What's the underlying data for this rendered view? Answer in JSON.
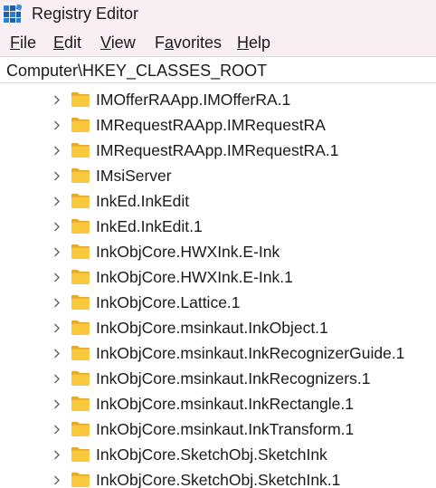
{
  "window": {
    "title": "Registry Editor",
    "icon": "registry-editor-icon"
  },
  "menu": [
    {
      "mnemonic": "F",
      "rest": "ile"
    },
    {
      "mnemonic": "E",
      "rest": "dit"
    },
    {
      "mnemonic": "V",
      "rest": "iew"
    },
    {
      "mnemonic": "",
      "pre": "F",
      "mid": "a",
      "post": "vorites"
    },
    {
      "mnemonic": "H",
      "rest": "elp"
    }
  ],
  "address": {
    "path": "Computer\\HKEY_CLASSES_ROOT"
  },
  "tree": {
    "items": [
      {
        "label": "IMOfferRAApp.IMOfferRA.1"
      },
      {
        "label": "IMRequestRAApp.IMRequestRA"
      },
      {
        "label": "IMRequestRAApp.IMRequestRA.1"
      },
      {
        "label": "IMsiServer"
      },
      {
        "label": "InkEd.InkEdit"
      },
      {
        "label": "InkEd.InkEdit.1"
      },
      {
        "label": "InkObjCore.HWXInk.E-Ink"
      },
      {
        "label": "InkObjCore.HWXInk.E-Ink.1"
      },
      {
        "label": "InkObjCore.Lattice.1"
      },
      {
        "label": "InkObjCore.msinkaut.InkObject.1"
      },
      {
        "label": "InkObjCore.msinkaut.InkRecognizerGuide.1"
      },
      {
        "label": "InkObjCore.msinkaut.InkRecognizers.1"
      },
      {
        "label": "InkObjCore.msinkaut.InkRectangle.1"
      },
      {
        "label": "InkObjCore.msinkaut.InkTransform.1"
      },
      {
        "label": "InkObjCore.SketchObj.SketchInk"
      },
      {
        "label": "InkObjCore.SketchObj.SketchInk.1"
      }
    ]
  },
  "colors": {
    "chrome_bg": "#f8eef3",
    "folder_fill": "#f9c83c",
    "folder_tab": "#e8a92a"
  }
}
